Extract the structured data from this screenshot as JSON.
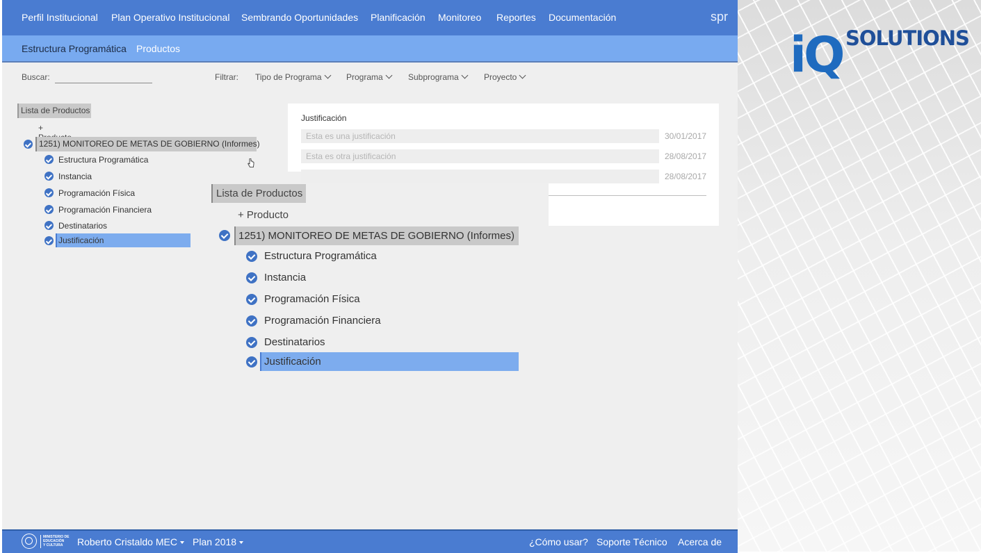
{
  "nav": {
    "items": [
      "Perfil Institucional",
      "Plan Operativo Institucional",
      "Sembrando Oportunidades",
      "Planificación",
      "Monitoreo",
      "Reportes",
      "Documentación"
    ],
    "brand": "spr"
  },
  "subnav": {
    "items": [
      "Estructura Programática",
      "Productos"
    ],
    "active": "Productos"
  },
  "filters": {
    "search_label": "Buscar:",
    "filter_label": "Filtrar:",
    "dropdowns": [
      "Tipo de Programa",
      "Programa",
      "Subprograma",
      "Proyecto"
    ]
  },
  "tree": {
    "header": "Lista de Productos",
    "add_label": "+ Producto",
    "product": "1251) MONITOREO DE METAS DE GOBIERNO (Informes)",
    "children": [
      "Estructura Programática",
      "Instancia",
      "Programación Física",
      "Programación Financiera",
      "Destinatarios",
      "Justificación"
    ],
    "selected": "Justificación"
  },
  "justificacion": {
    "title": "Justificación",
    "rows": [
      {
        "text": "Esta es una justificación",
        "date": "30/01/2017"
      },
      {
        "text": "Esta es otra justificación",
        "date": "28/08/2017"
      },
      {
        "text": "",
        "date": "28/08/2017"
      }
    ]
  },
  "footer": {
    "ministry": [
      "MINISTERIO DE",
      "EDUCACIÓN",
      "Y CULTURA"
    ],
    "user": "Roberto Cristaldo MEC",
    "plan": "Plan 2018",
    "links": [
      "¿Cómo usar?",
      "Soporte Técnico",
      "Acerca de"
    ]
  },
  "logo": {
    "iq": "iQ",
    "solutions": "SOLUTIONS"
  },
  "colors": {
    "primary": "#4a7cd1",
    "subnav": "#78aaf0",
    "selected": "#7dacee",
    "check": "#3f72c4"
  }
}
